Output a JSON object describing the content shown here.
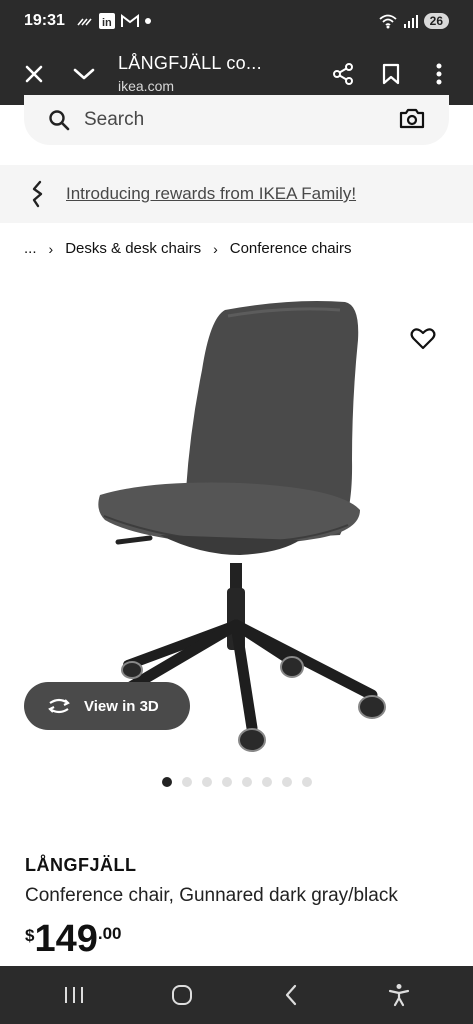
{
  "status_bar": {
    "time": "19:31",
    "battery": "26"
  },
  "browser": {
    "title": "LÅNGFJÄLL co...",
    "url": "ikea.com"
  },
  "search": {
    "placeholder": "Search"
  },
  "promo": {
    "text": "Introducing rewards from IKEA Family!"
  },
  "breadcrumb": {
    "ellipsis": "...",
    "items": [
      "Desks & desk chairs",
      "Conference chairs"
    ]
  },
  "view3d": {
    "label": "View in 3D"
  },
  "carousel": {
    "count": 8,
    "active_index": 0
  },
  "product": {
    "name": "LÅNGFJÄLL",
    "description": "Conference chair, Gunnared dark gray/black",
    "price_currency": "$",
    "price_integer": "149",
    "price_decimal": ".00"
  },
  "colors": {
    "bar_bg": "#2b2b2b",
    "promo_bg": "#f5f5f5",
    "view3d_bg": "#4a4a4a"
  }
}
